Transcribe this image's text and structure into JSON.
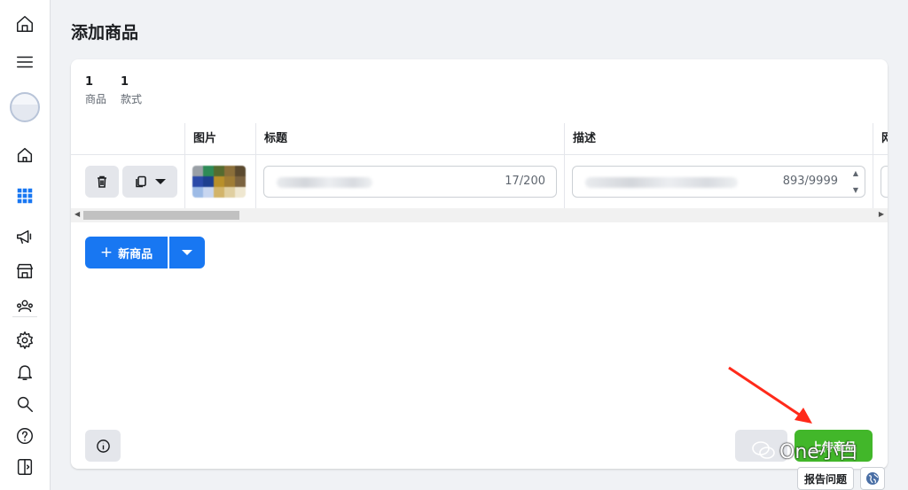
{
  "page": {
    "title": "添加商品"
  },
  "stats": [
    {
      "num": "1",
      "label": "商品"
    },
    {
      "num": "1",
      "label": "款式"
    }
  ],
  "table": {
    "columns": [
      "图片",
      "标题",
      "描述",
      "网"
    ],
    "row": {
      "title_count": "17/200",
      "description_count": "893/9999"
    }
  },
  "actions": {
    "new_item": "新商品",
    "cancel": "",
    "upload": "上传商品"
  },
  "watermark": {
    "text": "One小白"
  },
  "footer": {
    "report": "报告问题"
  },
  "colors": {
    "primary": "#1877f2",
    "success": "#42b72a",
    "background": "#f0f2f5",
    "annotation_arrow": "#ff2a1a"
  },
  "icons": [
    "home-icon",
    "menu-icon",
    "avatar",
    "shop-home-icon",
    "grid-icon",
    "megaphone-icon",
    "storefront-icon",
    "people-settings-icon",
    "gear-icon",
    "bell-icon",
    "search-icon",
    "help-icon",
    "panel-toggle-icon",
    "trash-icon",
    "duplicate-icon",
    "info-icon",
    "globe-icon"
  ]
}
